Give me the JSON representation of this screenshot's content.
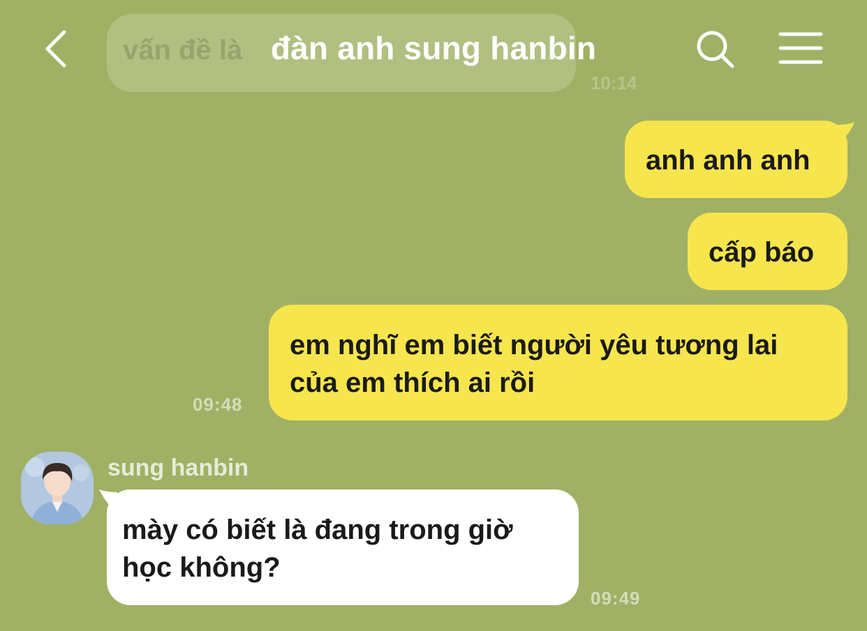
{
  "header": {
    "title": "đàn anh sung hanbin",
    "back_icon": "chevron-left-icon",
    "search_icon": "search-icon",
    "menu_icon": "hamburger-menu-icon"
  },
  "colors": {
    "background": "#a0b165",
    "my_bubble": "#f7e54d",
    "their_bubble": "#ffffff"
  },
  "previous_message": {
    "text": "vấn đề là",
    "time": "10:14"
  },
  "messages": [
    {
      "sender": "me",
      "text": "anh anh anh"
    },
    {
      "sender": "me",
      "text": "cấp báo"
    },
    {
      "sender": "me",
      "text_line1": "em nghĩ em biết người yêu tương lai",
      "text_line2": "của em thích ai rồi",
      "time": "09:48"
    },
    {
      "sender": "sung hanbin",
      "text_line1": "mày có biết là đang trong giờ",
      "text_line2": "học không?",
      "time": "09:49"
    }
  ],
  "contact": {
    "name": "sung hanbin",
    "avatar_icon": "profile-photo-avatar"
  }
}
